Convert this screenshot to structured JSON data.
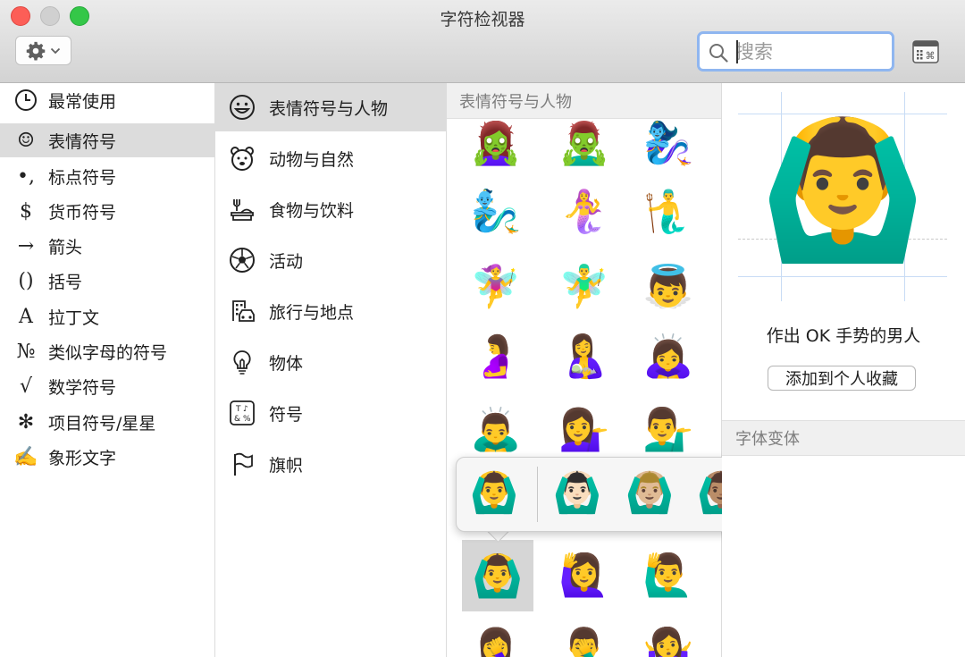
{
  "window": {
    "title": "字符检视器"
  },
  "toolbar": {
    "search_placeholder": "搜索"
  },
  "categories": [
    {
      "label": "最常使用",
      "icon": "clock-icon",
      "glyph": ""
    },
    {
      "label": "表情符号",
      "icon": "smiley-icon",
      "glyph": "☺",
      "selected": true
    },
    {
      "label": "标点符号",
      "icon": "punctuation-icon",
      "glyph": "•,"
    },
    {
      "label": "货币符号",
      "icon": "dollar-icon",
      "glyph": "$"
    },
    {
      "label": "箭头",
      "icon": "arrow-icon",
      "glyph": "→"
    },
    {
      "label": "括号",
      "icon": "parentheses-icon",
      "glyph": "()"
    },
    {
      "label": "拉丁文",
      "icon": "latin-letter-icon",
      "glyph": "A"
    },
    {
      "label": "类似字母的符号",
      "icon": "numero-icon",
      "glyph": "№"
    },
    {
      "label": "数学符号",
      "icon": "square-root-icon",
      "glyph": "√"
    },
    {
      "label": "项目符号/星星",
      "icon": "asterisk-icon",
      "glyph": "✻"
    },
    {
      "label": "象形文字",
      "icon": "pen-writing-icon",
      "glyph": "✍"
    }
  ],
  "subcategories": [
    {
      "label": "表情符号与人物",
      "icon": "smiley-icon",
      "selected": true
    },
    {
      "label": "动物与自然",
      "icon": "bear-icon"
    },
    {
      "label": "食物与饮料",
      "icon": "food-icon"
    },
    {
      "label": "活动",
      "icon": "soccer-ball-icon"
    },
    {
      "label": "旅行与地点",
      "icon": "building-car-icon"
    },
    {
      "label": "物体",
      "icon": "lightbulb-icon"
    },
    {
      "label": "符号",
      "icon": "symbols-icon"
    },
    {
      "label": "旗帜",
      "icon": "flag-icon"
    }
  ],
  "grid": {
    "header": "表情符号与人物",
    "rows": [
      [
        "🧟‍♀️",
        "🧟‍♂️",
        "🧞‍♀️"
      ],
      [
        "🧞‍♂️",
        "🧜‍♀️",
        "🧜‍♂️"
      ],
      [
        "🧚‍♀️",
        "🧚‍♂️",
        "👼"
      ],
      [
        "🤰",
        "🤱",
        "🙇‍♀️"
      ],
      [
        "🙇‍♂️",
        "💁‍♀️",
        "💁‍♂️"
      ],
      [
        "",
        "",
        ""
      ],
      [
        "🙆‍♂️",
        "🙋‍♀️",
        "🙋‍♂️"
      ],
      [
        "🤦‍♀️",
        "🤦‍♂️",
        "🤷‍♀️"
      ]
    ]
  },
  "skin_tones": [
    "🙆‍♂️",
    "🙆🏻‍♂️",
    "🙆🏼‍♂️",
    "🙆🏽‍♂️",
    "🙆🏾‍♂️",
    "🙆🏿‍♂️"
  ],
  "detail": {
    "emoji": "🙆‍♂️",
    "name": "作出 OK 手势的男人",
    "add_favorite": "添加到个人收藏",
    "variants_header": "字体变体"
  }
}
